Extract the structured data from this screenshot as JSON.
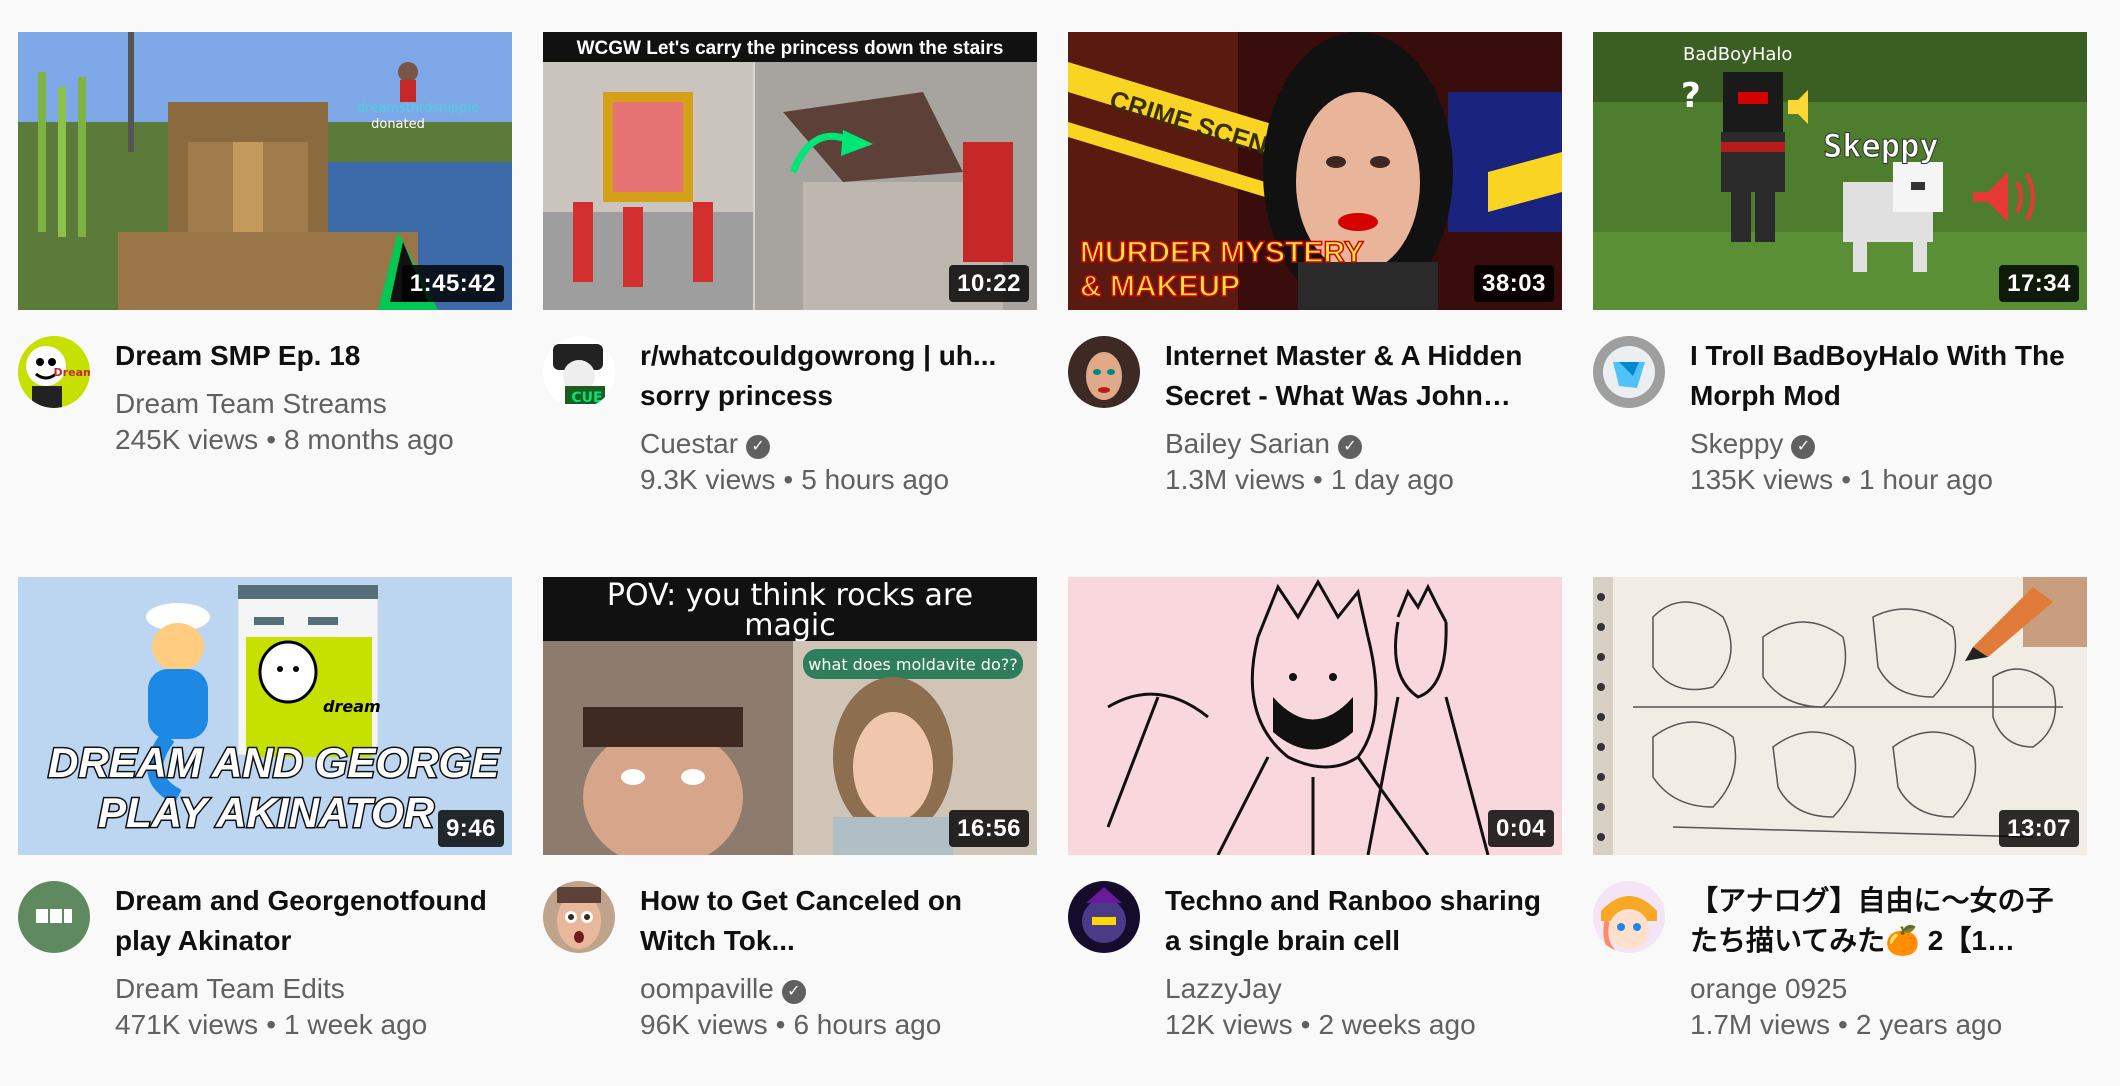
{
  "videos": [
    {
      "title": "Dream SMP Ep. 18",
      "channel": "Dream Team Streams",
      "verified": false,
      "views": "245K views",
      "age": "8 months ago",
      "duration": "1:45:42",
      "thumb_text": [
        "dreamsthrdsnipple",
        "donated"
      ],
      "avatar_text": "Dream"
    },
    {
      "title": "r/whatcouldgowrong | uh... sorry princess",
      "channel": "Cuestar",
      "verified": true,
      "views": "9.3K views",
      "age": "5 hours ago",
      "duration": "10:22",
      "thumb_text": [
        "WCGW Let's carry the princess down the stairs"
      ],
      "avatar_text": "CUE"
    },
    {
      "title": "Internet Master & A Hidden Secret - What Was John…",
      "channel": "Bailey Sarian",
      "verified": true,
      "views": "1.3M views",
      "age": "1 day ago",
      "duration": "38:03",
      "thumb_text": [
        "CRIME SCENE",
        "MURDER MYSTERY",
        "& MAKEUP"
      ],
      "avatar_text": ""
    },
    {
      "title": "I Troll BadBoyHalo With The Morph Mod",
      "channel": "Skeppy",
      "verified": true,
      "views": "135K views",
      "age": "1 hour ago",
      "duration": "17:34",
      "thumb_text": [
        "BadBoyHalo",
        "Skeppy",
        "?"
      ],
      "avatar_text": ""
    },
    {
      "title": "Dream and Georgenotfound play Akinator",
      "channel": "Dream Team Edits",
      "verified": false,
      "views": "471K views",
      "age": "1 week ago",
      "duration": "9:46",
      "thumb_text": [
        "DREAM AND GEORGE",
        "PLAY AKINATOR",
        "dream"
      ],
      "avatar_text": ""
    },
    {
      "title": "How to Get Canceled on Witch Tok...",
      "channel": "oompaville",
      "verified": true,
      "views": "96K views",
      "age": "6 hours ago",
      "duration": "16:56",
      "thumb_text": [
        "POV: you think rocks are",
        "magic",
        "what does moldavite do??"
      ],
      "avatar_text": ""
    },
    {
      "title": "Techno and Ranboo sharing a single brain cell",
      "channel": "LazzyJay",
      "verified": false,
      "views": "12K views",
      "age": "2 weeks ago",
      "duration": "0:04",
      "thumb_text": [],
      "avatar_text": ""
    },
    {
      "title": "【アナログ】自由に～女の子たち描いてみた🍊 2【1…",
      "channel": "orange 0925",
      "verified": false,
      "views": "1.7M views",
      "age": "2 years ago",
      "duration": "13:07",
      "thumb_text": [],
      "avatar_text": ""
    }
  ],
  "ui": {
    "separator": "•",
    "verified_icon": "check-circle-icon",
    "verified_glyph": "✓"
  },
  "colors": {
    "text_primary": "#0f0f0f",
    "text_secondary": "#606060",
    "background": "#f9f9f9"
  }
}
